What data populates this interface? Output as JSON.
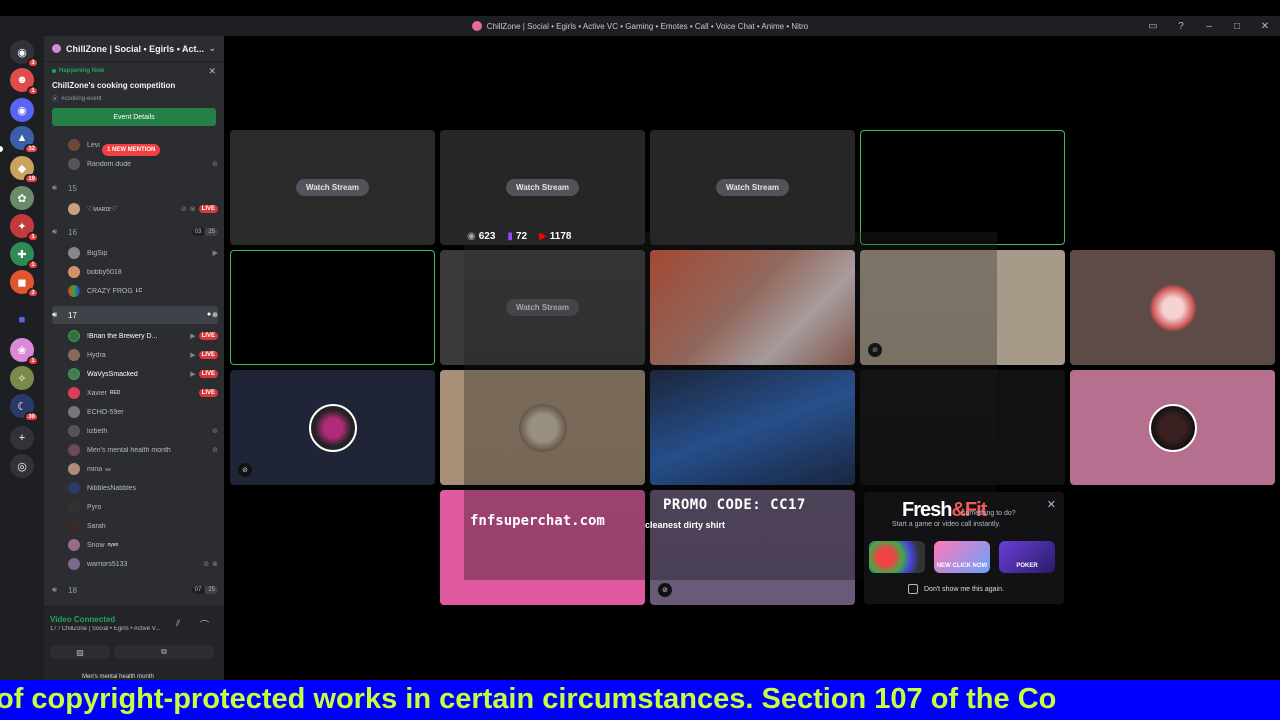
{
  "window": {
    "title": "ChillZone | Social • Egirls • Active VC • Gaming • Emotes • Call • Voice Chat • Anime • Nitro"
  },
  "servers": [
    {
      "badge": "3"
    },
    {
      "badge": "1"
    },
    {
      "badge": ""
    },
    {
      "badge": "32"
    },
    {
      "badge": "19"
    },
    {
      "badge": ""
    },
    {
      "badge": "1"
    },
    {
      "badge": "1"
    },
    {
      "badge": "3"
    },
    {
      "badge": "1"
    },
    {
      "badge": ""
    },
    {
      "badge": ""
    },
    {
      "badge": "1"
    },
    {
      "badge": "30"
    }
  ],
  "sidebar": {
    "server_name": "ChillZone | Social • Egirls • Act...",
    "event": {
      "status": "Happening Now",
      "title": "ChillZone's cooking competition",
      "location": "#cooking-event",
      "button": "Event Details"
    },
    "mention_pill": "1 NEW MENTION",
    "users_top": [
      {
        "name": "Levi"
      },
      {
        "name": "Random.dude"
      }
    ],
    "channel_15": {
      "name": "15"
    },
    "user_marie": {
      "name": "♡ᴍᴀʀɪᴇ♡",
      "live": "LIVE"
    },
    "channel_16": {
      "name": "16",
      "count_a": "03",
      "count_b": "25"
    },
    "users_16": [
      {
        "name": "BigSip"
      },
      {
        "name": "bobby5018"
      },
      {
        "name": "CRAZY FROG",
        "tag": "LC"
      }
    ],
    "channel_17": {
      "name": "17"
    },
    "users_17": [
      {
        "name": "!Brian the Brewery D...",
        "live": "LIVE"
      },
      {
        "name": "Hydra",
        "live": "LIVE"
      },
      {
        "name": "WaVysSmacked",
        "live": "LIVE"
      },
      {
        "name": "Xavier",
        "tag": "RED",
        "live": "LIVE"
      },
      {
        "name": "ECHO-59er"
      },
      {
        "name": "lizbeth"
      },
      {
        "name": "Men's mental health month"
      },
      {
        "name": "mina",
        "tag": "ₓ₀ₓ"
      },
      {
        "name": "NibblesNabbles"
      },
      {
        "name": "Pyro"
      },
      {
        "name": "Sarah"
      },
      {
        "name": "Snow",
        "tag": "nyan"
      },
      {
        "name": "warriors5133"
      }
    ],
    "channel_18": {
      "name": "18",
      "count_a": "07",
      "count_b": "25"
    },
    "voice": {
      "status": "Video Connected",
      "channel": "17 / ChillZone | Social • Egirls • Active V..."
    },
    "user_strip": "Men's mental health month"
  },
  "stage": {
    "watch_label": "Watch Stream",
    "stats": {
      "a": "623",
      "b": "72",
      "c": "1178"
    },
    "fnf_text": "fnfsuperchat.com",
    "promo": "PROMO CODE: CC17",
    "promo_sub": "cleanest dirty shirt"
  },
  "popup": {
    "logo_a": "Fresh",
    "logo_b": "&Fit",
    "q1": "something to do?",
    "q2": "Start a game or video call instantly.",
    "act1": "",
    "act2": "NEW CLICK NOW",
    "act3": "POKER",
    "dont_show": "Don't show me this again."
  },
  "ticker": "of copyright-protected works in certain circumstances. Section 107 of the Co",
  "colors": {
    "green": "#23a55a",
    "red": "#f23f43",
    "blurple": "#5865f2",
    "ticker_bg": "#0000ff",
    "ticker_fg": "#c7ff3d"
  }
}
